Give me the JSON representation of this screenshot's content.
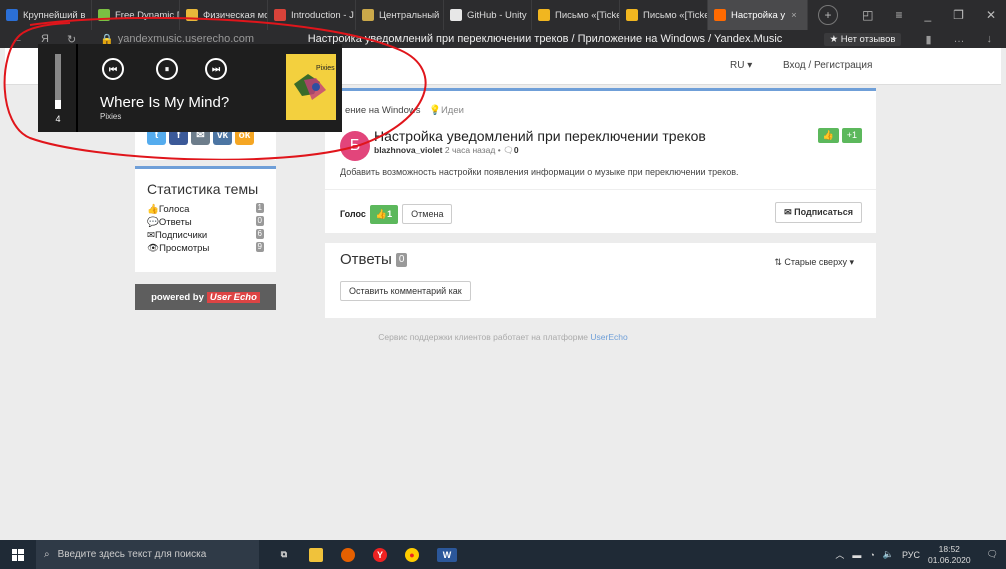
{
  "browser": {
    "tabs": [
      {
        "label": "Крупнейший в",
        "color": "#2b6fd6"
      },
      {
        "label": "Free Dynamic D",
        "color": "#7bc043"
      },
      {
        "label": "Физическая мо",
        "color": "#e8b83a"
      },
      {
        "label": "Introduction - J",
        "color": "#d9433a"
      },
      {
        "label": "Центральный",
        "color": "#caa84a"
      },
      {
        "label": "GitHub - Unity",
        "color": "#e7e7e7"
      },
      {
        "label": "Письмо «[Ticke",
        "color": "#f1b620"
      },
      {
        "label": "Письмо «[Ticke",
        "color": "#f1b620"
      },
      {
        "label": "Настройка у",
        "color": "#ff6a00",
        "active": true
      }
    ],
    "url": "yandexmusic.userecho.com",
    "page_title": "Настройка уведомлений при переключении треков / Приложение на Windows / Yandex.Music",
    "review_button": "★ Нет отзывов"
  },
  "site": {
    "lang": "RU ▾",
    "login": "Вход / Регистрация"
  },
  "sidebar": {
    "stats_title": "Статистика темы",
    "stats": [
      {
        "label": "Голоса",
        "count": "1"
      },
      {
        "label": "Ответы",
        "count": "0"
      },
      {
        "label": "Подписчики",
        "count": "6"
      },
      {
        "label": "Просмотры",
        "count": "9"
      }
    ],
    "powered": "powered by",
    "powered_brand": "User Echo"
  },
  "topic": {
    "breadcrumb": "ение на Windows",
    "category": "Идеи",
    "avatar_letter": "Б",
    "title": "Настройка уведомлений при переключении треков",
    "author": "blazhnova_violet",
    "time": "2 часа назад",
    "comments": "0",
    "votes": "+1",
    "description": "Добавить возможность настройки появления информации о музыке при переключении треков.",
    "vote_label": "Голос",
    "vote_count": "1",
    "cancel": "Отмена",
    "subscribe": "Подписаться"
  },
  "answers": {
    "title": "Ответы",
    "count": "0",
    "sort": "Старые сверху ▾",
    "leave_comment": "Оставить комментарий как"
  },
  "footer": {
    "text": "Сервис поддержки клиентов работает на платформе",
    "link": "UserEcho"
  },
  "media": {
    "volume": "4",
    "volume_level": 0.16,
    "song": "Where Is My Mind?",
    "artist": "Pixies",
    "cover_text": "Pixies"
  },
  "taskbar": {
    "search_placeholder": "Введите здесь текст для поиска",
    "lang": "РУС",
    "time": "18:52",
    "date": "01.06.2020"
  }
}
